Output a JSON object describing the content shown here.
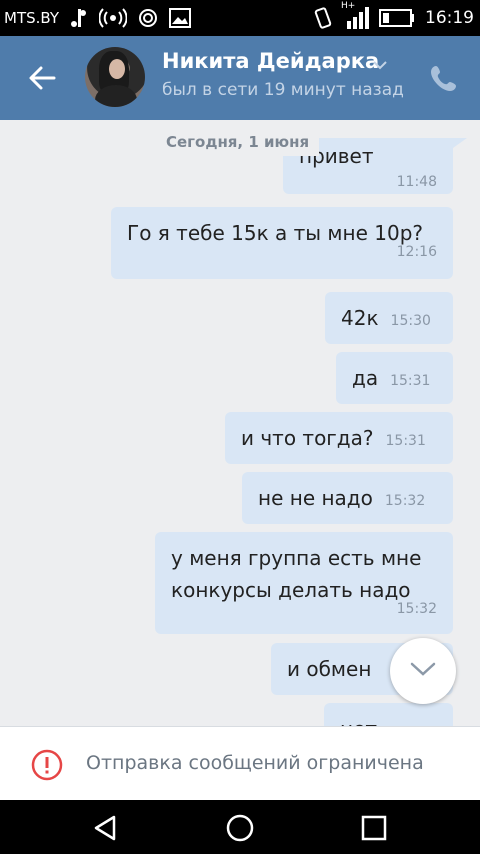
{
  "status_bar": {
    "carrier": "MTS.BY",
    "network_type": "H+",
    "time": "16:19",
    "icons": [
      "usb-icon",
      "signal-broadcast-icon",
      "target-icon",
      "gallery-icon",
      "vibrate-icon",
      "cell-signal-icon",
      "battery-icon"
    ]
  },
  "header": {
    "contact_name": "Никита Дейдарка",
    "contact_status": "был в сети 19 минут назад",
    "icons": [
      "back-arrow-icon",
      "chevron-down-icon",
      "phone-icon"
    ],
    "background_color": "#4f7cab"
  },
  "chat": {
    "date_label": "Сегодня, 1 июня",
    "messages": [
      {
        "text": "привет",
        "time": "11:48"
      },
      {
        "text": "Го я тебе 15к а ты мне 10р?",
        "time": "12:16"
      },
      {
        "text": "42к",
        "time": "15:30"
      },
      {
        "text": "да",
        "time": "15:31"
      },
      {
        "text": "и что тогда?",
        "time": "15:31"
      },
      {
        "text": "не не надо",
        "time": "15:32"
      },
      {
        "text": "у меня группа есть мне конкурсы делать надо",
        "time": "15:32"
      },
      {
        "text": "и обмен",
        "time": ""
      },
      {
        "text": "нет",
        "time": ""
      }
    ],
    "bubble_color": "#d9e6f5"
  },
  "scroll_down_button": {
    "icon": "chevron-down-icon"
  },
  "notice": {
    "text": "Отправка сообщений ограничена",
    "icon": "alert-circle-icon",
    "icon_color": "#e64646"
  },
  "nav_bar": {
    "icons": [
      "back-triangle-icon",
      "home-circle-icon",
      "recents-square-icon"
    ]
  }
}
